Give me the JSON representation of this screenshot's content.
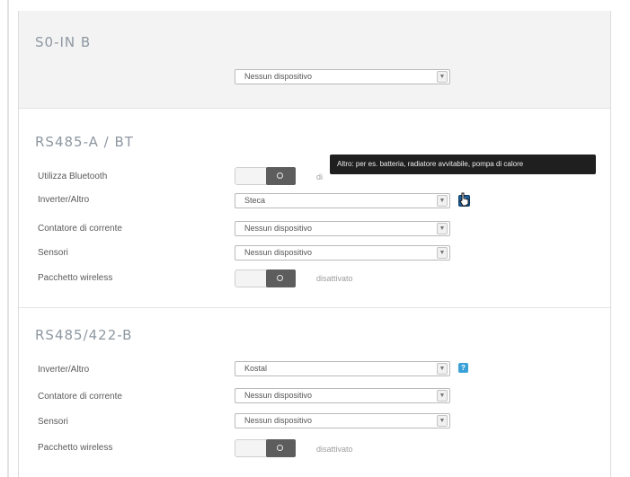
{
  "top_strip": {
    "left_text": "",
    "mid_text": ""
  },
  "sections": {
    "s0_in_b": {
      "title": "S0-IN B",
      "device_select": "Nessun dispositivo"
    },
    "rs485_a_bt": {
      "title": "RS485-A / BT",
      "rows": {
        "bluetooth_label": "Utilizza Bluetooth",
        "bluetooth_state": "di",
        "inverter_label": "Inverter/Altro",
        "inverter_value": "Steca",
        "meter_label": "Contatore di corrente",
        "meter_value": "Nessun dispositivo",
        "sensors_label": "Sensori",
        "sensors_value": "Nessun dispositivo",
        "wireless_label": "Pacchetto wireless",
        "wireless_state": "disattivato"
      }
    },
    "rs485_422_b": {
      "title": "RS485/422-B",
      "rows": {
        "inverter_label": "Inverter/Altro",
        "inverter_value": "Kostal",
        "meter_label": "Contatore di corrente",
        "meter_value": "Nessun dispositivo",
        "sensors_label": "Sensori",
        "sensors_value": "Nessun dispositivo",
        "wireless_label": "Pacchetto wireless",
        "wireless_state": "disattivato"
      }
    }
  },
  "tooltip": {
    "text": "Altro: per es. batteria, radiatore avvitabile, pompa di calore"
  },
  "icons": {
    "help": "?",
    "dropdown_arrow": "▼"
  },
  "colors": {
    "help_icon": "#39a1d8",
    "help_icon_active": "#1f5f98",
    "toggle_knob": "#5d5d5d",
    "section_title": "#8e97a0"
  }
}
